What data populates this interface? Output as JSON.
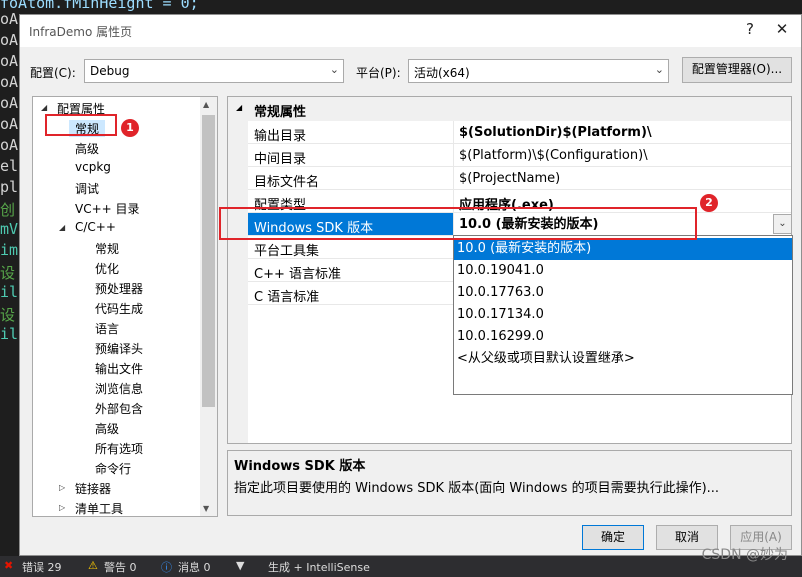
{
  "colors": {
    "accent": "#0078d7",
    "annotation": "#e0242a"
  },
  "background_code": {
    "top_line": "foAtom.fMinHeight = 0;",
    "lines": [
      {
        "text": "oA",
        "color": "#d4d4d4"
      },
      {
        "text": "oA",
        "color": "#d4d4d4"
      },
      {
        "text": "oA",
        "color": "#d4d4d4"
      },
      {
        "text": "oA",
        "color": "#d4d4d4"
      },
      {
        "text": "oA",
        "color": "#d4d4d4"
      },
      {
        "text": "oA",
        "color": "#d4d4d4"
      },
      {
        "text": "oA",
        "color": "#d4d4d4"
      },
      {
        "text": "el",
        "color": "#d4d4d4"
      },
      {
        "text": "pl",
        "color": "#d4d4d4"
      },
      {
        "text": "创",
        "color": "#57a64a"
      },
      {
        "text": "mV",
        "color": "#4ec9b0"
      },
      {
        "text": "im",
        "color": "#4ec9b0"
      },
      {
        "text": "设",
        "color": "#57a64a"
      },
      {
        "text": "il",
        "color": "#4ec9b0"
      },
      {
        "text": "设",
        "color": "#57a64a"
      },
      {
        "text": "il",
        "color": "#4ec9b0"
      }
    ]
  },
  "dialog": {
    "title": "InfraDemo 属性页",
    "help_button": "?",
    "close_button": "✕",
    "config_label": "配置(C):",
    "config_value": "Debug",
    "platform_label": "平台(P):",
    "platform_value": "活动(x64)",
    "config_manager_button": "配置管理器(O)...",
    "ok_button": "确定",
    "cancel_button": "取消",
    "apply_button": "应用(A)"
  },
  "tree": {
    "root": "配置属性",
    "items": [
      {
        "label": "常规",
        "indent": 1,
        "toggle": ""
      },
      {
        "label": "高级",
        "indent": 1,
        "toggle": ""
      },
      {
        "label": "vcpkg",
        "indent": 1,
        "toggle": ""
      },
      {
        "label": "调试",
        "indent": 1,
        "toggle": ""
      },
      {
        "label": "VC++ 目录",
        "indent": 1,
        "toggle": ""
      },
      {
        "label": "C/C++",
        "indent": 1,
        "toggle": "◢"
      },
      {
        "label": "常规",
        "indent": 2,
        "toggle": ""
      },
      {
        "label": "优化",
        "indent": 2,
        "toggle": ""
      },
      {
        "label": "预处理器",
        "indent": 2,
        "toggle": ""
      },
      {
        "label": "代码生成",
        "indent": 2,
        "toggle": ""
      },
      {
        "label": "语言",
        "indent": 2,
        "toggle": ""
      },
      {
        "label": "预编译头",
        "indent": 2,
        "toggle": ""
      },
      {
        "label": "输出文件",
        "indent": 2,
        "toggle": ""
      },
      {
        "label": "浏览信息",
        "indent": 2,
        "toggle": ""
      },
      {
        "label": "外部包含",
        "indent": 2,
        "toggle": ""
      },
      {
        "label": "高级",
        "indent": 2,
        "toggle": ""
      },
      {
        "label": "所有选项",
        "indent": 2,
        "toggle": ""
      },
      {
        "label": "命令行",
        "indent": 2,
        "toggle": ""
      },
      {
        "label": "链接器",
        "indent": 1,
        "toggle": "▷"
      },
      {
        "label": "清单工具",
        "indent": 1,
        "toggle": "▷"
      }
    ]
  },
  "grid": {
    "category": "常规属性",
    "rows": [
      {
        "name": "输出目录",
        "value": "$(SolutionDir)$(Platform)\\",
        "bold": true
      },
      {
        "name": "中间目录",
        "value": "$(Platform)\\$(Configuration)\\",
        "bold": false
      },
      {
        "name": "目标文件名",
        "value": "$(ProjectName)",
        "bold": false
      },
      {
        "name": "配置类型",
        "value": "应用程序(.exe)",
        "bold": true
      },
      {
        "name": "Windows SDK 版本",
        "value": "10.0 (最新安装的版本)",
        "bold": true
      },
      {
        "name": "平台工具集",
        "value": "",
        "bold": false
      },
      {
        "name": "C++ 语言标准",
        "value": "",
        "bold": false
      },
      {
        "name": "C 语言标准",
        "value": "",
        "bold": false
      }
    ],
    "dropdown_options": [
      "10.0 (最新安装的版本)",
      "10.0.19041.0",
      "10.0.17763.0",
      "10.0.17134.0",
      "10.0.16299.0",
      "<从父级或项目默认设置继承>"
    ]
  },
  "description": {
    "heading": "Windows SDK 版本",
    "body": "指定此项目要使用的 Windows SDK 版本(面向 Windows 的项目需要执行此操作)..."
  },
  "annotations": {
    "badge1": "1",
    "badge2": "2"
  },
  "statusbar": {
    "errors": "错误 29",
    "warnings": "警告 0",
    "messages": "消息 0",
    "build": "生成 + IntelliSense"
  },
  "watermark": "CSDN @妙为"
}
